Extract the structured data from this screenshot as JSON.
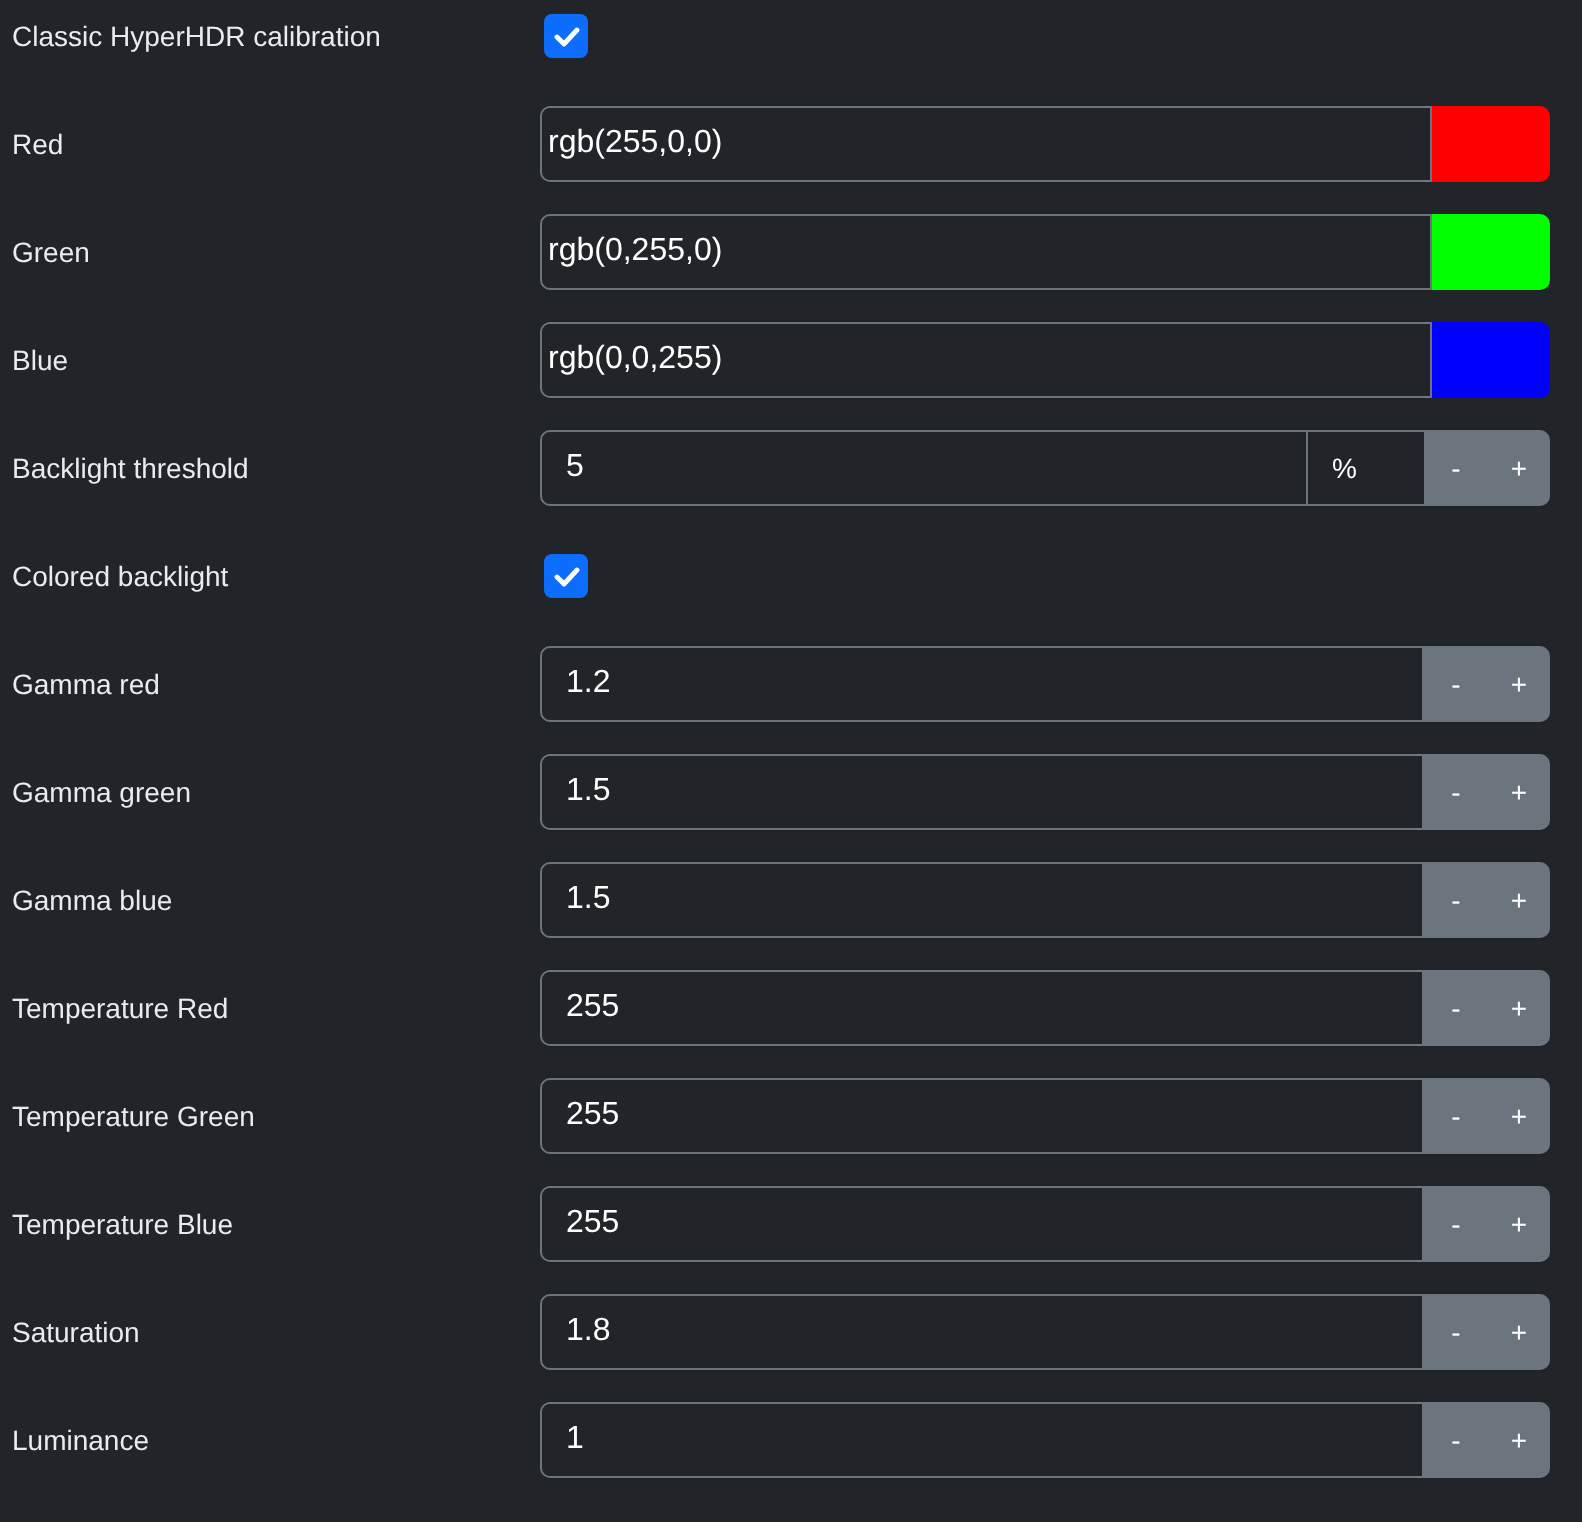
{
  "rows": [
    {
      "kind": "checkbox",
      "label": "Classic HyperHDR calibration",
      "checked": true
    },
    {
      "kind": "color",
      "label": "Red",
      "value": "rgb(255,0,0)",
      "color": "#ff0000"
    },
    {
      "kind": "color",
      "label": "Green",
      "value": "rgb(0,255,0)",
      "color": "#00ff00"
    },
    {
      "kind": "color",
      "label": "Blue",
      "value": "rgb(0,0,255)",
      "color": "#0000ff"
    },
    {
      "kind": "unit",
      "label": "Backlight threshold",
      "value": "5",
      "unit": "%",
      "minus": "-",
      "plus": "+"
    },
    {
      "kind": "checkbox",
      "label": "Colored backlight",
      "checked": true
    },
    {
      "kind": "number",
      "label": "Gamma red",
      "value": "1.2",
      "minus": "-",
      "plus": "+"
    },
    {
      "kind": "number",
      "label": "Gamma green",
      "value": "1.5",
      "minus": "-",
      "plus": "+"
    },
    {
      "kind": "number",
      "label": "Gamma blue",
      "value": "1.5",
      "minus": "-",
      "plus": "+"
    },
    {
      "kind": "number",
      "label": "Temperature Red",
      "value": "255",
      "minus": "-",
      "plus": "+"
    },
    {
      "kind": "number",
      "label": "Temperature Green",
      "value": "255",
      "minus": "-",
      "plus": "+"
    },
    {
      "kind": "number",
      "label": "Temperature Blue",
      "value": "255",
      "minus": "-",
      "plus": "+"
    },
    {
      "kind": "number",
      "label": "Saturation",
      "value": "1.8",
      "minus": "-",
      "plus": "+"
    },
    {
      "kind": "number",
      "label": "Luminance",
      "value": "1",
      "minus": "-",
      "plus": "+"
    }
  ]
}
